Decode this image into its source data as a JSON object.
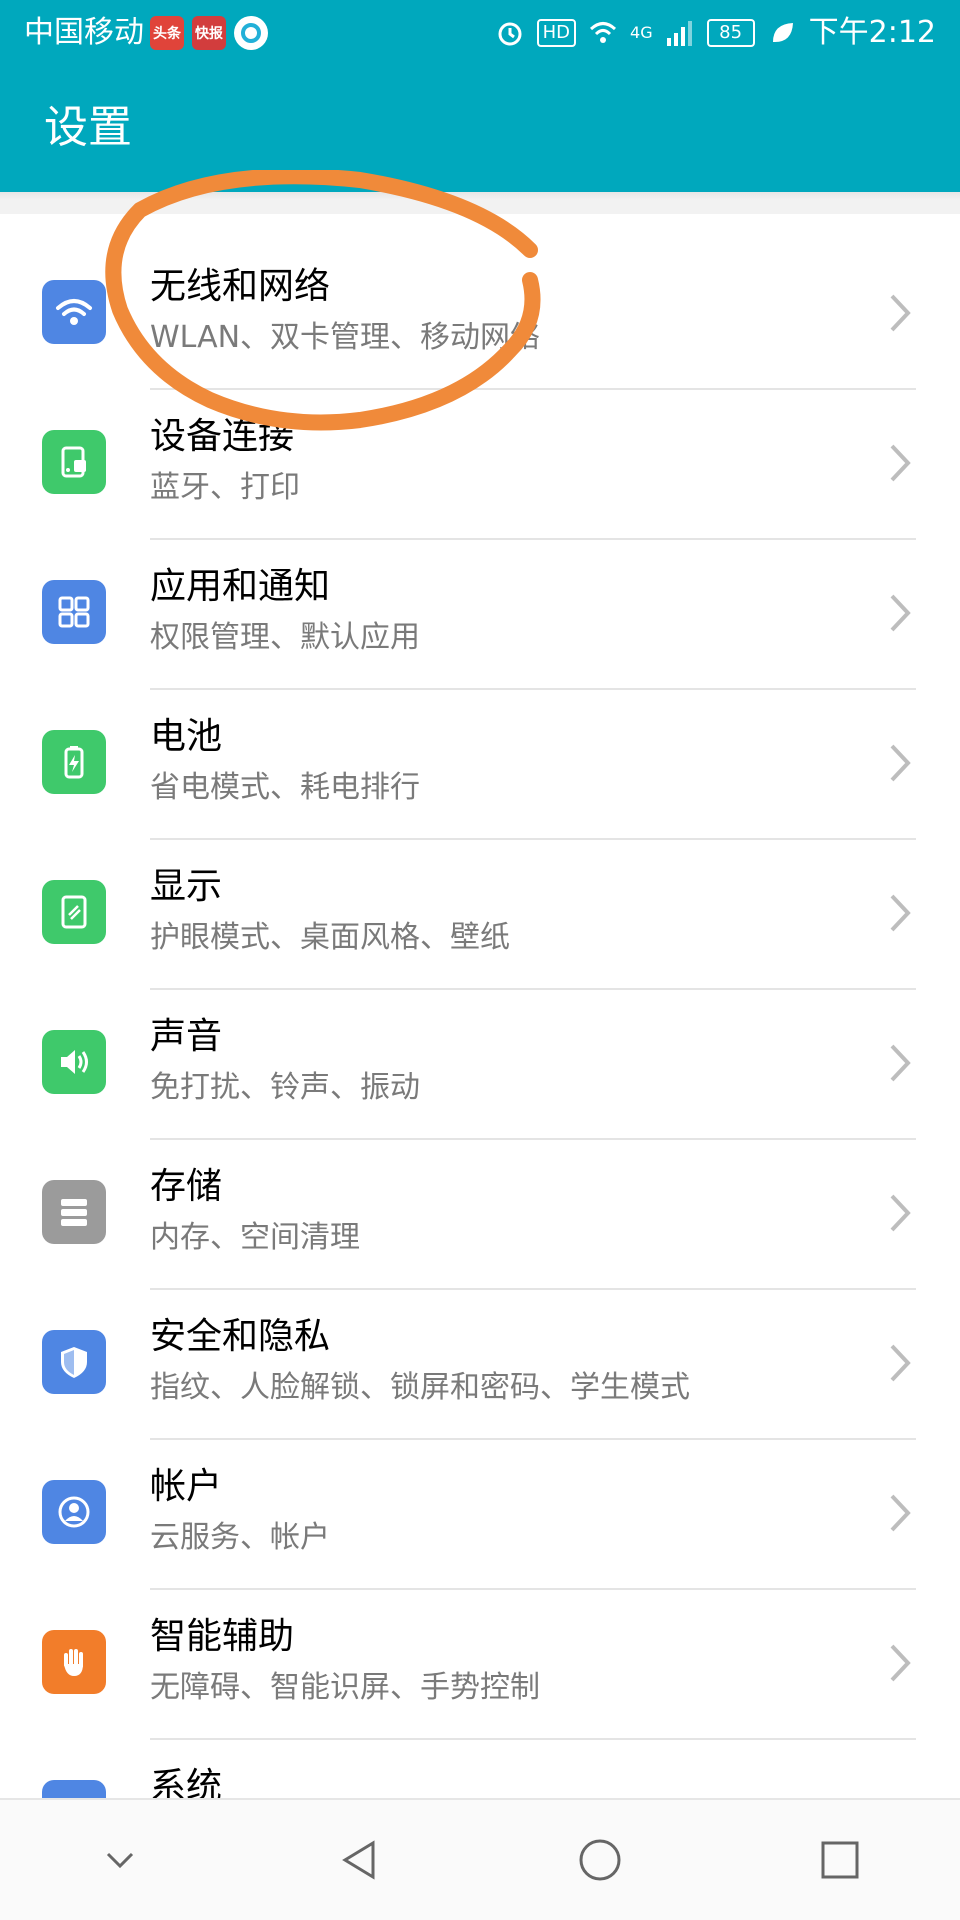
{
  "status_bar": {
    "carrier": "中国移动",
    "notif1": "头条",
    "notif2": "快报",
    "network": "4G",
    "hd": "HD",
    "battery": "85",
    "time": "下午2:12"
  },
  "app_bar": {
    "title": "设置"
  },
  "settings": [
    {
      "title": "无线和网络",
      "subtitle": "WLAN、双卡管理、移动网络",
      "icon": "wifi-icon",
      "color": "#4f86e3"
    },
    {
      "title": "设备连接",
      "subtitle": "蓝牙、打印",
      "icon": "device-connect-icon",
      "color": "#3fc96b"
    },
    {
      "title": "应用和通知",
      "subtitle": "权限管理、默认应用",
      "icon": "apps-grid-icon",
      "color": "#4f86e3"
    },
    {
      "title": "电池",
      "subtitle": "省电模式、耗电排行",
      "icon": "battery-icon",
      "color": "#3fc96b"
    },
    {
      "title": "显示",
      "subtitle": "护眼模式、桌面风格、壁纸",
      "icon": "display-icon",
      "color": "#3fc96b"
    },
    {
      "title": "声音",
      "subtitle": "免打扰、铃声、振动",
      "icon": "speaker-icon",
      "color": "#3fc96b"
    },
    {
      "title": "存储",
      "subtitle": "内存、空间清理",
      "icon": "storage-icon",
      "color": "#9b9b9b"
    },
    {
      "title": "安全和隐私",
      "subtitle": "指纹、人脸解锁、锁屏和密码、学生模式",
      "icon": "shield-icon",
      "color": "#4f86e3"
    },
    {
      "title": "帐户",
      "subtitle": "云服务、帐户",
      "icon": "account-icon",
      "color": "#4f86e3"
    },
    {
      "title": "智能辅助",
      "subtitle": "无障碍、智能识屏、手势控制",
      "icon": "hand-icon",
      "color": "#f27d2a"
    },
    {
      "title": "系统",
      "subtitle": "",
      "icon": "system-icon",
      "color": "#4f86e3"
    }
  ],
  "colors": {
    "header": "#00a8bd",
    "annotation": "#f08a3a"
  }
}
